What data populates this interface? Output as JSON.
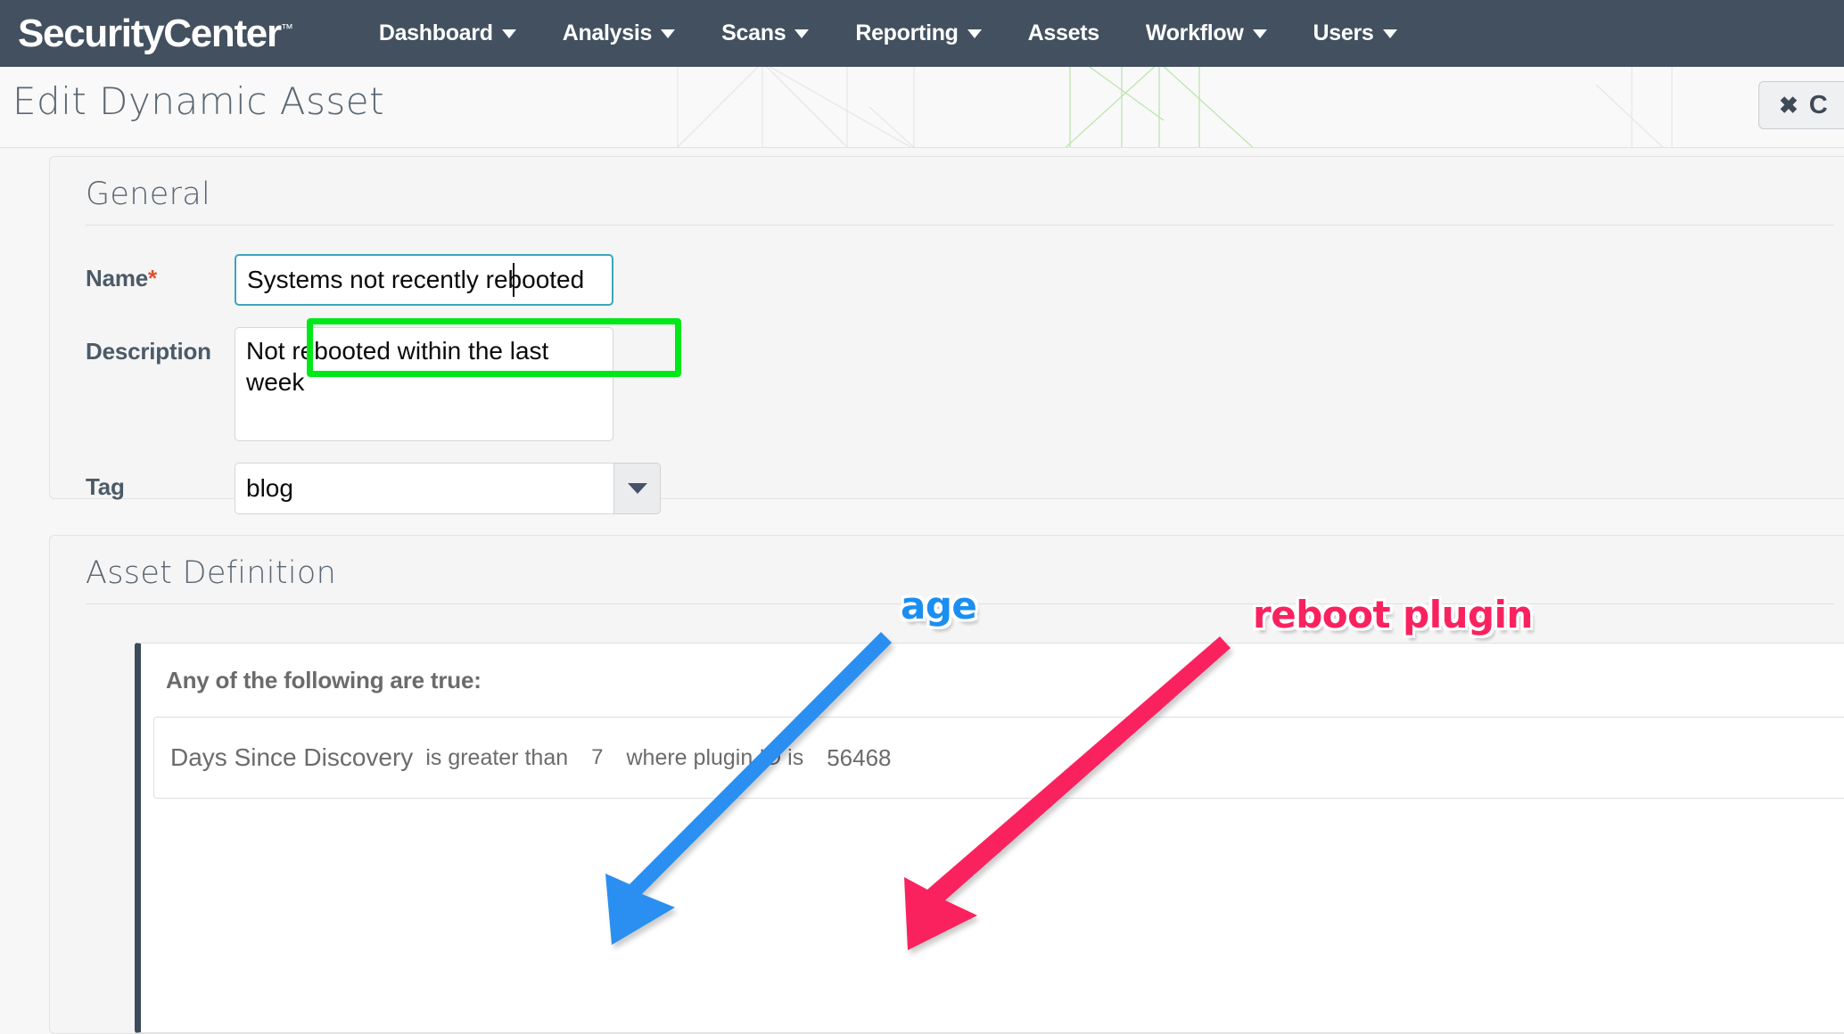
{
  "topnav": {
    "brand": "SecurityCenter",
    "brand_tm": "™",
    "items": [
      {
        "label": "Dashboard",
        "has_caret": true
      },
      {
        "label": "Analysis",
        "has_caret": true
      },
      {
        "label": "Scans",
        "has_caret": true
      },
      {
        "label": "Reporting",
        "has_caret": true
      },
      {
        "label": "Assets",
        "has_caret": false
      },
      {
        "label": "Workflow",
        "has_caret": true
      },
      {
        "label": "Users",
        "has_caret": true
      }
    ],
    "background_color": "#42505f"
  },
  "pageheader": {
    "title": "Edit Dynamic Asset",
    "cancel_button": {
      "icon": "close-x-icon",
      "glyph": "✖",
      "label": "C"
    }
  },
  "general": {
    "section_title": "General",
    "name": {
      "label": "Name",
      "required_marker": "*",
      "value": "Systems not recently rebooted",
      "placeholder": ""
    },
    "description": {
      "label": "Description",
      "value": "Not rebooted within the last week",
      "placeholder": ""
    },
    "tag": {
      "label": "Tag",
      "value": "blog",
      "placeholder": "",
      "dropdown_icon": "chevron-down-icon"
    }
  },
  "asset_definition": {
    "section_title": "Asset Definition",
    "group_title": "Any of the following are true:",
    "rule": {
      "field": "Days Since Discovery",
      "operator": "is greater than",
      "value": "7",
      "sub_label": "where plugin ID is",
      "sub_value": "56468"
    }
  },
  "annotations": {
    "age": {
      "text": "age",
      "color": "#1b8ef2"
    },
    "reboot_plugin": {
      "text": "reboot plugin",
      "color": "#f9225f"
    },
    "name_highlight_color": "#00e817"
  }
}
